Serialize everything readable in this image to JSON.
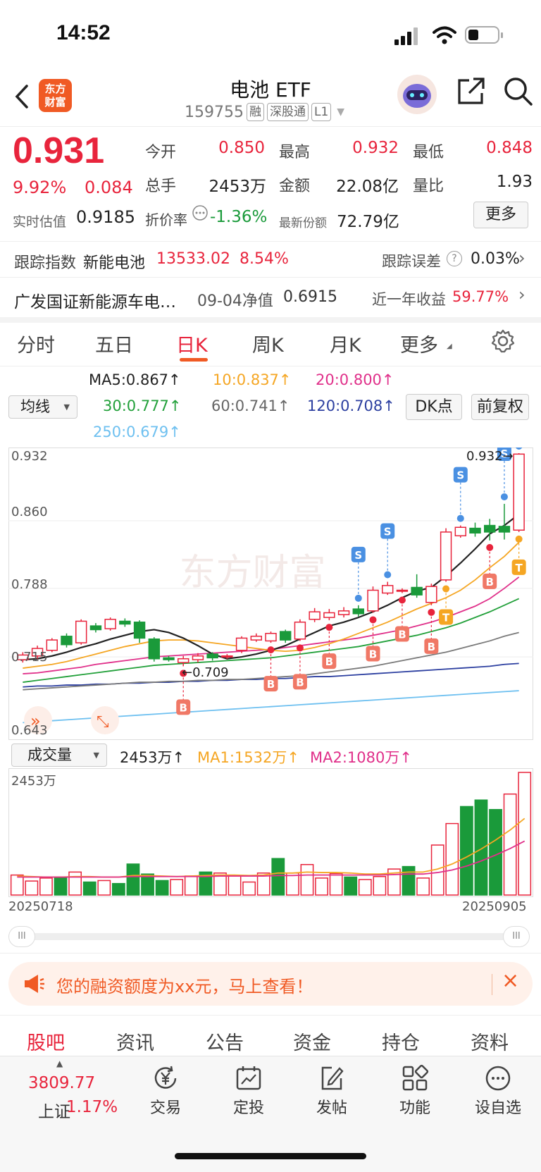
{
  "status": {
    "time": "14:52"
  },
  "header": {
    "logo_text": "东方财富",
    "title": "电池 ETF",
    "code": "159755",
    "tags": [
      "融",
      "深股通",
      "L1"
    ]
  },
  "quote": {
    "price": "0.931",
    "change_pct": "9.92%",
    "change": "0.084",
    "est_label": "实时估值",
    "est_value": "0.9185",
    "open_label": "今开",
    "open": "0.850",
    "high_label": "最高",
    "high": "0.932",
    "low_label": "最低",
    "low": "0.848",
    "vol_label": "总手",
    "vol": "2453万",
    "amount_label": "金额",
    "amount": "22.08亿",
    "ratio_label": "量比",
    "ratio": "1.93",
    "premium_label": "折价率",
    "premium": "-1.36%",
    "shares_label": "最新份额",
    "shares": "72.79亿",
    "more_label": "更多"
  },
  "tracking": {
    "label": "跟踪指数",
    "index_name": "新能电池",
    "index_value": "13533.02",
    "index_pct": "8.54%",
    "error_label": "跟踪误差",
    "error_value": "0.03%"
  },
  "fund": {
    "name": "广发国证新能源车电…",
    "nav_label": "09-04净值",
    "nav": "0.6915",
    "return_label": "近一年收益",
    "return_value": "59.77%"
  },
  "ktabs": [
    "分时",
    "五日",
    "日K",
    "周K",
    "月K",
    "更多"
  ],
  "active_ktab": 2,
  "ma_legend": {
    "selector": "均线",
    "ma5": "MA5:0.867",
    "ma10": "10:0.837",
    "ma20": "20:0.800",
    "ma30": "30:0.777",
    "ma60": "60:0.741",
    "ma120": "120:0.708",
    "ma250": "250:0.679",
    "dk_label": "DK点",
    "adjust_label": "前复权"
  },
  "colors": {
    "up": "#e8243c",
    "down": "#1a9a3a",
    "ma5": "#222222",
    "ma10": "#f5a623",
    "ma20": "#e0308a",
    "ma30": "#22a03a",
    "ma60": "#7a7a7a",
    "ma120": "#2c3fa0",
    "ma250": "#6ec0f0"
  },
  "price_axis": {
    "top": "0.932",
    "mid1": "0.860",
    "mid2": "0.788",
    "mid3": "0.715",
    "bottom": "0.643"
  },
  "annotations": {
    "high_mark": "0.932",
    "low_mark": "0.709"
  },
  "volume_legend": {
    "selector": "成交量",
    "vol": "2453万",
    "ma1": "MA1:1532万",
    "ma2": "MA2:1080万",
    "axis_top": "2453万"
  },
  "chart_data": {
    "type": "candlestick",
    "ylim": [
      0.643,
      0.932
    ],
    "x_start": "20250718",
    "x_end": "20250905",
    "candles": [
      {
        "o": 0.712,
        "c": 0.717,
        "h": 0.72,
        "l": 0.709
      },
      {
        "o": 0.716,
        "c": 0.724,
        "h": 0.727,
        "l": 0.713
      },
      {
        "o": 0.722,
        "c": 0.733,
        "h": 0.735,
        "l": 0.72
      },
      {
        "o": 0.737,
        "c": 0.728,
        "h": 0.74,
        "l": 0.725
      },
      {
        "o": 0.73,
        "c": 0.753,
        "h": 0.755,
        "l": 0.728
      },
      {
        "o": 0.748,
        "c": 0.744,
        "h": 0.751,
        "l": 0.741
      },
      {
        "o": 0.745,
        "c": 0.755,
        "h": 0.757,
        "l": 0.743
      },
      {
        "o": 0.753,
        "c": 0.75,
        "h": 0.756,
        "l": 0.747
      },
      {
        "o": 0.752,
        "c": 0.735,
        "h": 0.754,
        "l": 0.73
      },
      {
        "o": 0.734,
        "c": 0.713,
        "h": 0.736,
        "l": 0.71
      },
      {
        "o": 0.714,
        "c": 0.712,
        "h": 0.716,
        "l": 0.71
      },
      {
        "o": 0.709,
        "c": 0.713,
        "h": 0.716,
        "l": 0.705
      },
      {
        "o": 0.712,
        "c": 0.716,
        "h": 0.719,
        "l": 0.709
      },
      {
        "o": 0.718,
        "c": 0.714,
        "h": 0.72,
        "l": 0.711
      },
      {
        "o": 0.716,
        "c": 0.716,
        "h": 0.718,
        "l": 0.713
      },
      {
        "o": 0.722,
        "c": 0.735,
        "h": 0.737,
        "l": 0.719
      },
      {
        "o": 0.733,
        "c": 0.737,
        "h": 0.74,
        "l": 0.731
      },
      {
        "o": 0.732,
        "c": 0.74,
        "h": 0.742,
        "l": 0.73
      },
      {
        "o": 0.742,
        "c": 0.733,
        "h": 0.744,
        "l": 0.73
      },
      {
        "o": 0.734,
        "c": 0.752,
        "h": 0.755,
        "l": 0.732
      },
      {
        "o": 0.755,
        "c": 0.763,
        "h": 0.767,
        "l": 0.752
      },
      {
        "o": 0.757,
        "c": 0.762,
        "h": 0.766,
        "l": 0.754
      },
      {
        "o": 0.76,
        "c": 0.764,
        "h": 0.768,
        "l": 0.757
      },
      {
        "o": 0.766,
        "c": 0.761,
        "h": 0.77,
        "l": 0.758
      },
      {
        "o": 0.764,
        "c": 0.786,
        "h": 0.79,
        "l": 0.762
      },
      {
        "o": 0.783,
        "c": 0.791,
        "h": 0.795,
        "l": 0.781
      },
      {
        "o": 0.786,
        "c": 0.786,
        "h": 0.788,
        "l": 0.783
      },
      {
        "o": 0.789,
        "c": 0.781,
        "h": 0.803,
        "l": 0.778
      },
      {
        "o": 0.773,
        "c": 0.79,
        "h": 0.793,
        "l": 0.77
      },
      {
        "o": 0.797,
        "c": 0.848,
        "h": 0.852,
        "l": 0.795
      },
      {
        "o": 0.844,
        "c": 0.853,
        "h": 0.855,
        "l": 0.842
      },
      {
        "o": 0.852,
        "c": 0.847,
        "h": 0.858,
        "l": 0.843
      },
      {
        "o": 0.855,
        "c": 0.848,
        "h": 0.862,
        "l": 0.839
      },
      {
        "o": 0.854,
        "c": 0.848,
        "h": 0.878,
        "l": 0.84
      },
      {
        "o": 0.85,
        "c": 0.931,
        "h": 0.932,
        "l": 0.848
      }
    ],
    "ma5": [
      0.712,
      0.713,
      0.716,
      0.72,
      0.725,
      0.729,
      0.734,
      0.738,
      0.742,
      0.744,
      0.741,
      0.735,
      0.727,
      0.718,
      0.713,
      0.715,
      0.718,
      0.722,
      0.727,
      0.734,
      0.741,
      0.748,
      0.752,
      0.757,
      0.763,
      0.77,
      0.778,
      0.785,
      0.789,
      0.801,
      0.815,
      0.83,
      0.846,
      0.855,
      0.867
    ],
    "ma10": [
      0.703,
      0.705,
      0.707,
      0.71,
      0.714,
      0.718,
      0.722,
      0.726,
      0.729,
      0.732,
      0.733,
      0.733,
      0.732,
      0.73,
      0.728,
      0.726,
      0.724,
      0.722,
      0.721,
      0.722,
      0.725,
      0.729,
      0.734,
      0.74,
      0.746,
      0.752,
      0.759,
      0.766,
      0.772,
      0.778,
      0.786,
      0.797,
      0.81,
      0.822,
      0.837
    ],
    "ma20": [
      0.697,
      0.698,
      0.7,
      0.702,
      0.704,
      0.707,
      0.709,
      0.711,
      0.713,
      0.715,
      0.716,
      0.717,
      0.718,
      0.719,
      0.72,
      0.721,
      0.722,
      0.723,
      0.725,
      0.727,
      0.729,
      0.731,
      0.733,
      0.735,
      0.738,
      0.741,
      0.744,
      0.748,
      0.752,
      0.757,
      0.763,
      0.769,
      0.777,
      0.788,
      0.8
    ],
    "ma30": [
      0.688,
      0.69,
      0.692,
      0.694,
      0.696,
      0.698,
      0.7,
      0.702,
      0.704,
      0.706,
      0.707,
      0.708,
      0.709,
      0.71,
      0.711,
      0.712,
      0.713,
      0.714,
      0.716,
      0.718,
      0.72,
      0.722,
      0.724,
      0.726,
      0.729,
      0.732,
      0.735,
      0.738,
      0.742,
      0.746,
      0.751,
      0.757,
      0.763,
      0.77,
      0.777
    ],
    "ma60": [
      0.68,
      0.681,
      0.682,
      0.683,
      0.684,
      0.685,
      0.686,
      0.687,
      0.688,
      0.688,
      0.689,
      0.689,
      0.69,
      0.69,
      0.691,
      0.691,
      0.692,
      0.693,
      0.694,
      0.695,
      0.697,
      0.699,
      0.701,
      0.703,
      0.705,
      0.708,
      0.711,
      0.714,
      0.717,
      0.72,
      0.724,
      0.728,
      0.732,
      0.737,
      0.741
    ],
    "ma120": [
      0.683,
      0.684,
      0.684,
      0.685,
      0.685,
      0.686,
      0.686,
      0.687,
      0.687,
      0.688,
      0.688,
      0.689,
      0.689,
      0.69,
      0.69,
      0.691,
      0.691,
      0.692,
      0.692,
      0.693,
      0.694,
      0.694,
      0.695,
      0.696,
      0.697,
      0.698,
      0.699,
      0.7,
      0.701,
      0.702,
      0.703,
      0.704,
      0.705,
      0.707,
      0.708
    ],
    "ma250": [
      0.645,
      0.646,
      0.647,
      0.648,
      0.649,
      0.65,
      0.651,
      0.652,
      0.653,
      0.654,
      0.655,
      0.656,
      0.657,
      0.658,
      0.659,
      0.66,
      0.661,
      0.662,
      0.663,
      0.664,
      0.665,
      0.666,
      0.667,
      0.668,
      0.669,
      0.67,
      0.671,
      0.672,
      0.673,
      0.674,
      0.675,
      0.676,
      0.677,
      0.678,
      0.679
    ],
    "volume": [
      400,
      280,
      340,
      360,
      460,
      260,
      290,
      230,
      620,
      420,
      290,
      310,
      380,
      460,
      440,
      390,
      260,
      440,
      730,
      440,
      610,
      340,
      430,
      360,
      310,
      370,
      520,
      570,
      340,
      1000,
      1430,
      1770,
      1900,
      1710,
      2020,
      2453
    ],
    "vol_ma1": [
      380,
      370,
      360,
      360,
      370,
      370,
      360,
      360,
      390,
      390,
      380,
      370,
      380,
      390,
      400,
      400,
      390,
      400,
      440,
      440,
      460,
      450,
      450,
      440,
      420,
      420,
      440,
      460,
      460,
      520,
      620,
      760,
      920,
      1100,
      1300,
      1532
    ],
    "vol_ma2": [
      360,
      360,
      360,
      360,
      360,
      360,
      360,
      360,
      370,
      370,
      370,
      370,
      370,
      370,
      380,
      380,
      380,
      380,
      390,
      390,
      400,
      400,
      400,
      400,
      400,
      400,
      410,
      420,
      420,
      450,
      500,
      580,
      680,
      800,
      930,
      1080
    ],
    "signals": [
      {
        "i": 11,
        "t": "B"
      },
      {
        "i": 17,
        "t": "B"
      },
      {
        "i": 19,
        "t": "B"
      },
      {
        "i": 21,
        "t": "B"
      },
      {
        "i": 24,
        "t": "B"
      },
      {
        "i": 26,
        "t": "B"
      },
      {
        "i": 28,
        "t": "B"
      },
      {
        "i": 32,
        "t": "B"
      },
      {
        "i": 23,
        "t": "S"
      },
      {
        "i": 25,
        "t": "S"
      },
      {
        "i": 30,
        "t": "S"
      },
      {
        "i": 33,
        "t": "S"
      },
      {
        "i": 34,
        "t": "S"
      },
      {
        "i": 29,
        "t": "T"
      },
      {
        "i": 34,
        "t": "T"
      }
    ]
  },
  "scroll": {
    "left_handle": "III",
    "right_handle": "III"
  },
  "promo": {
    "text": "您的融资额度为xx元，马上查看！"
  },
  "footer_tabs": [
    "股吧",
    "资讯",
    "公告",
    "资金",
    "持仓",
    "资料"
  ],
  "active_footer_tab": 0,
  "bottom_nav": {
    "index_value": "3809.77",
    "index_name": "上证",
    "index_pct": "1.17%",
    "items": [
      "交易",
      "定投",
      "发帖",
      "功能",
      "设自选"
    ]
  }
}
